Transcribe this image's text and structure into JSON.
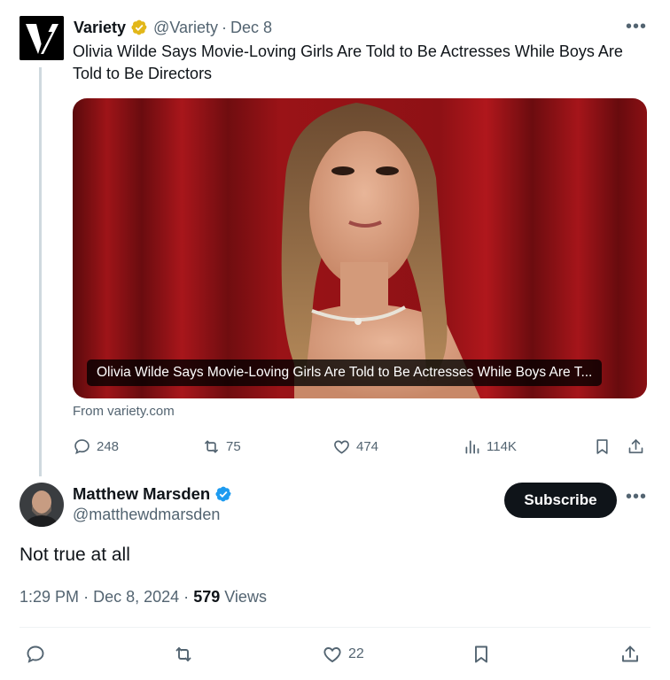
{
  "quoted": {
    "name": "Variety",
    "handle": "@Variety",
    "separator": "·",
    "date": "Dec 8",
    "more": "•••",
    "text": "Olivia Wilde Says Movie-Loving Girls Are Told to Be Actresses While Boys Are Told to Be Directors",
    "media_caption": "Olivia Wilde Says Movie-Loving Girls Are Told to Be Actresses While Boys Are T...",
    "source": "From variety.com",
    "actions": {
      "replies": "248",
      "reposts": "75",
      "likes": "474",
      "views": "114K"
    }
  },
  "reply": {
    "name": "Matthew Marsden",
    "handle": "@matthewdmarsden",
    "subscribe_label": "Subscribe",
    "more": "•••",
    "text": "Not true at all",
    "time": "1:29 PM",
    "separator": "·",
    "date": "Dec 8, 2024",
    "views_count": "579",
    "views_label": "Views",
    "actions": {
      "likes": "22"
    }
  },
  "colors": {
    "verified_gold": "#e2b719",
    "verified_blue": "#1d9bf0",
    "text": "#0f1419",
    "secondary": "#536471"
  },
  "icons": {
    "reply": "comment-bubble-icon",
    "repost": "repost-arrows-icon",
    "like": "heart-icon",
    "views": "bar-chart-icon",
    "bookmark": "bookmark-icon",
    "share": "share-upload-icon"
  }
}
